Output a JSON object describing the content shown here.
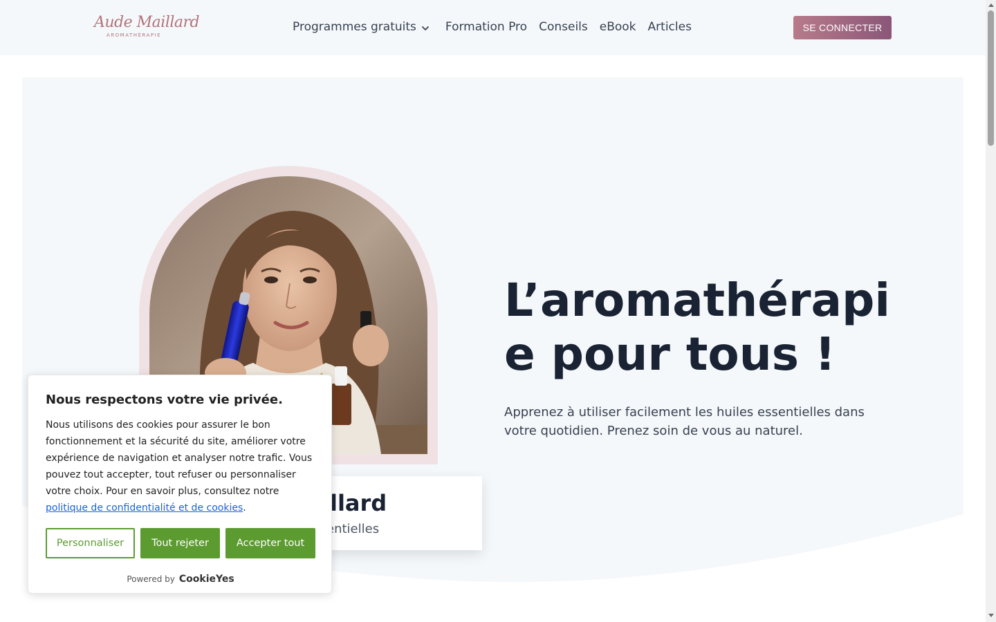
{
  "header": {
    "logo": {
      "script": "Aude Maillard",
      "sub": "AROMATHÉRAPIE"
    },
    "nav": [
      {
        "label": "Programmes gratuits",
        "has_dropdown": true
      },
      {
        "label": "Formation Pro"
      },
      {
        "label": "Conseils"
      },
      {
        "label": "eBook"
      },
      {
        "label": "Articles"
      }
    ],
    "login_label": "SE CONNECTER"
  },
  "hero": {
    "title": "L’aromathérapie pour tous !",
    "subtitle": "Apprenez à utiliser facilement les huiles essentielles dans votre quotidien. Prenez soin de vous au naturel.",
    "name_card": {
      "name": "illard",
      "role": "entielles"
    }
  },
  "cookie": {
    "title": "Nous respectons votre vie privée.",
    "text": "Nous utilisons des cookies pour assurer le bon fonctionnement et la sécurité du site, améliorer votre expérience de navigation et analyser notre trafic. Vous pouvez tout accepter, tout refuser ou personnaliser votre choix. Pour en savoir plus, consultez notre ",
    "link": "politique de confidentialité et de cookies",
    "period": ".",
    "buttons": {
      "customize": "Personnaliser",
      "reject": "Tout rejeter",
      "accept": "Accepter tout"
    },
    "powered_by": "Powered by",
    "brand": "CookieYes"
  },
  "colors": {
    "accent": "#8b5678",
    "cookie_green": "#5b9b2f",
    "hero_bg": "#f5f8fb",
    "title_color": "#1a2333"
  }
}
